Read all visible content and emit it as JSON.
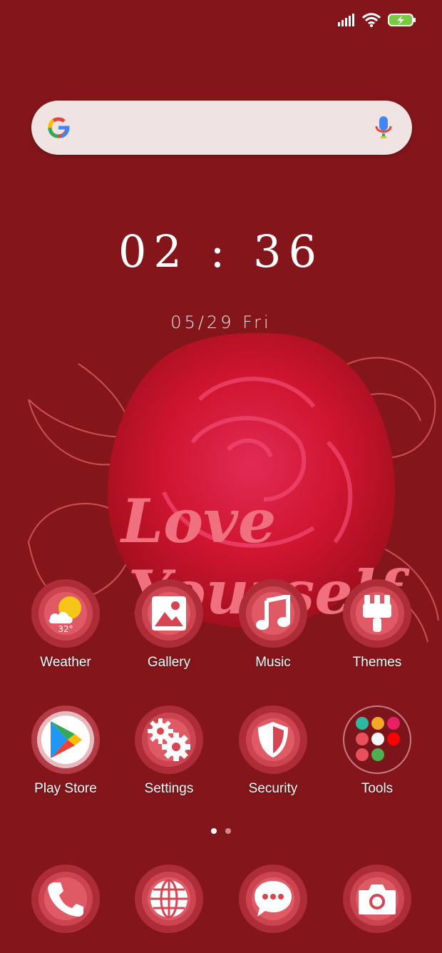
{
  "clock": {
    "time": "02 : 36",
    "date": "05/29  Fri"
  },
  "wallpaper": {
    "headline_line1": "Love",
    "headline_line2": "Yourself"
  },
  "weather": {
    "temp": "32°"
  },
  "apps_row1": [
    {
      "label": "Weather",
      "icon": "weather-icon"
    },
    {
      "label": "Gallery",
      "icon": "gallery-icon"
    },
    {
      "label": "Music",
      "icon": "music-icon"
    },
    {
      "label": "Themes",
      "icon": "themes-icon"
    }
  ],
  "apps_row2": [
    {
      "label": "Play Store",
      "icon": "play-store-icon"
    },
    {
      "label": "Settings",
      "icon": "settings-icon"
    },
    {
      "label": "Security",
      "icon": "security-icon"
    },
    {
      "label": "Tools",
      "icon": "tools-folder-icon"
    }
  ],
  "dock": [
    {
      "icon": "phone-icon"
    },
    {
      "icon": "browser-icon"
    },
    {
      "icon": "messages-icon"
    },
    {
      "icon": "camera-icon"
    }
  ],
  "page_indicator": {
    "pages": 2,
    "current": 1
  },
  "colors": {
    "background": "#84161b",
    "accent": "#e05a66",
    "battery": "#7ac943"
  }
}
